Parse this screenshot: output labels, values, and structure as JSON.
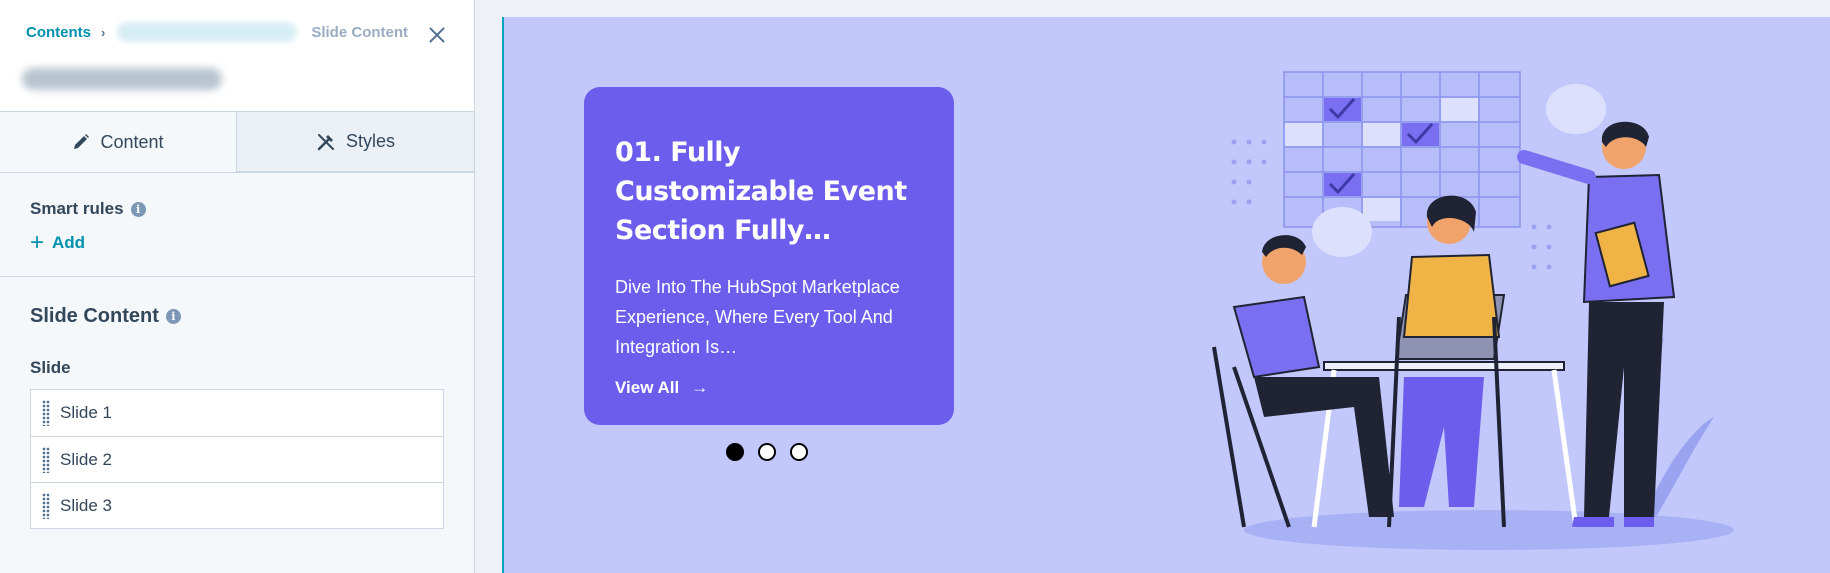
{
  "breadcrumb": {
    "root": "Contents",
    "separator": "›",
    "current": "Slide Content"
  },
  "tabs": [
    {
      "label": "Content",
      "icon": "pencil-icon",
      "active": true
    },
    {
      "label": "Styles",
      "icon": "brush-icon",
      "active": false
    }
  ],
  "smart_rules": {
    "label": "Smart rules",
    "add_label": "Add"
  },
  "slide_content": {
    "title": "Slide Content",
    "slide_label": "Slide",
    "slides": [
      "Slide 1",
      "Slide 2",
      "Slide 3"
    ]
  },
  "preview": {
    "card": {
      "title": "01. Fully Customizable Event Section Fully…",
      "description": "Dive Into The HubSpot Marketplace Experience, Where Every Tool And Integration Is…",
      "link": "View All",
      "link_icon": "arrow-right-icon"
    },
    "pagination": {
      "total": 3,
      "active": 1
    },
    "colors": {
      "background": "#c2c8fb",
      "card": "#6c5ded",
      "accent": "#0091ae"
    }
  }
}
